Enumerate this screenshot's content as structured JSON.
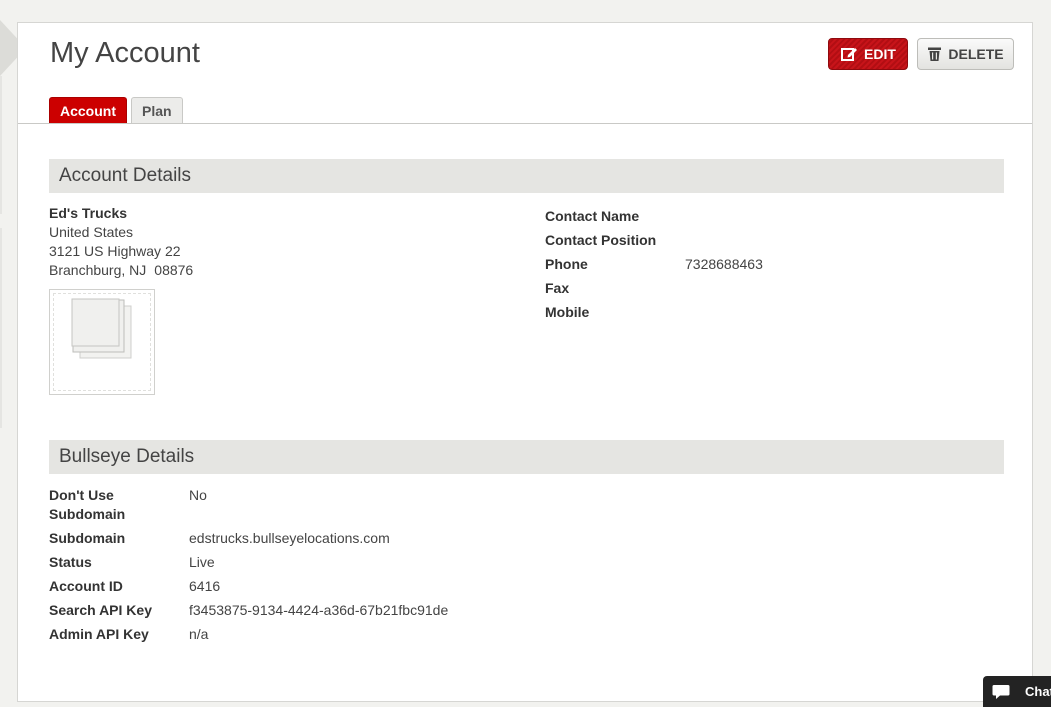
{
  "page": {
    "title": "My Account"
  },
  "toolbar": {
    "edit_label": "EDIT",
    "delete_label": "DELETE",
    "edit_color": "#c8141a"
  },
  "tabs": [
    {
      "label": "Account",
      "active": true
    },
    {
      "label": "Plan",
      "active": false
    }
  ],
  "account_details": {
    "heading": "Account Details",
    "company": "Ed's Trucks",
    "country": "United States",
    "street": "3121 US Highway 22",
    "city_state": "Branchburg, NJ",
    "zip": "08876",
    "logo_icon": "image-placeholder-icon",
    "contact": [
      {
        "label": "Contact Name",
        "value": ""
      },
      {
        "label": "Contact Position",
        "value": ""
      },
      {
        "label": "Phone",
        "value": "7328688463"
      },
      {
        "label": "Fax",
        "value": ""
      },
      {
        "label": "Mobile",
        "value": ""
      }
    ]
  },
  "bullseye_details": {
    "heading": "Bullseye Details",
    "rows": [
      {
        "label": "Don't Use Subdomain",
        "value": "No"
      },
      {
        "label": "Subdomain",
        "value": "edstrucks.bullseyelocations.com"
      },
      {
        "label": "Status",
        "value": "Live"
      },
      {
        "label": "Account ID",
        "value": "6416"
      },
      {
        "label": "Search API Key",
        "value": "f3453875-9134-4424-a36d-67b21fbc91de"
      },
      {
        "label": "Admin API Key",
        "value": "n/a"
      }
    ]
  },
  "chat": {
    "label": "Chat",
    "icon": "chat-bubble-icon"
  }
}
